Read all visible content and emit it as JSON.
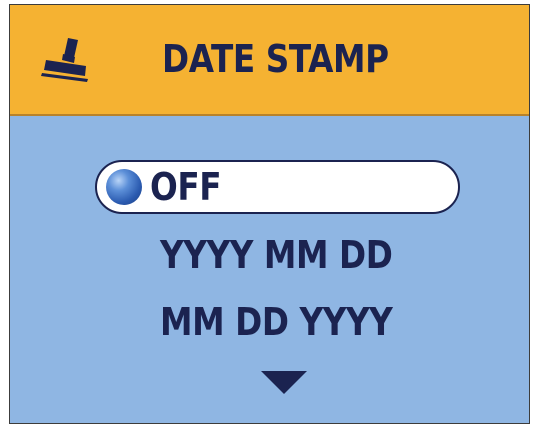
{
  "header": {
    "icon": "rubber-stamp-icon",
    "title": "DATE STAMP"
  },
  "menu": {
    "options": [
      {
        "label": "OFF",
        "selected": true
      },
      {
        "label": "YYYY MM DD",
        "selected": false
      },
      {
        "label": "MM DD YYYY",
        "selected": false
      }
    ],
    "more_indicator_icon": "down-arrow-icon"
  },
  "colors": {
    "header_bg": "#f5b232",
    "body_bg": "#8fb6e3",
    "text": "#1b2350",
    "selection_bg": "#ffffff",
    "radio": "#2b5bb0"
  }
}
